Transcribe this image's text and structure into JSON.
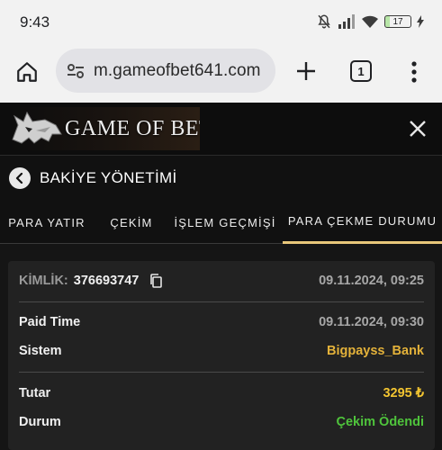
{
  "status_bar": {
    "time": "9:43",
    "battery_level": "17"
  },
  "browser": {
    "url": "m.gameofbet641.com",
    "tab_count": "1"
  },
  "site": {
    "logo_text": "GAME OF BET"
  },
  "page": {
    "title": "BAKİYE YÖNETİMİ"
  },
  "tabs": [
    {
      "label": "PARA YATIR"
    },
    {
      "label": "ÇEKİM"
    },
    {
      "label": "İŞLEM GEÇMİŞİ"
    },
    {
      "label": "PARA ÇEKME DURUMU"
    }
  ],
  "withdrawal": {
    "id_label": "KİMLİK:",
    "id_value": "376693747",
    "created_at": "09.11.2024, 09:25",
    "paid_time_label": "Paid Time",
    "paid_time_value": "09.11.2024, 09:30",
    "system_label": "Sistem",
    "system_value": "Bigpayss_Bank",
    "amount_label": "Tutar",
    "amount_value": "3295 ₺",
    "status_label": "Durum",
    "status_value": "Çekim Ödendi"
  },
  "colors": {
    "accent_gold": "#e4b23a",
    "amount_yellow": "#f3c531",
    "status_green": "#4fc43c",
    "tab_underline": "#e8c77a"
  }
}
